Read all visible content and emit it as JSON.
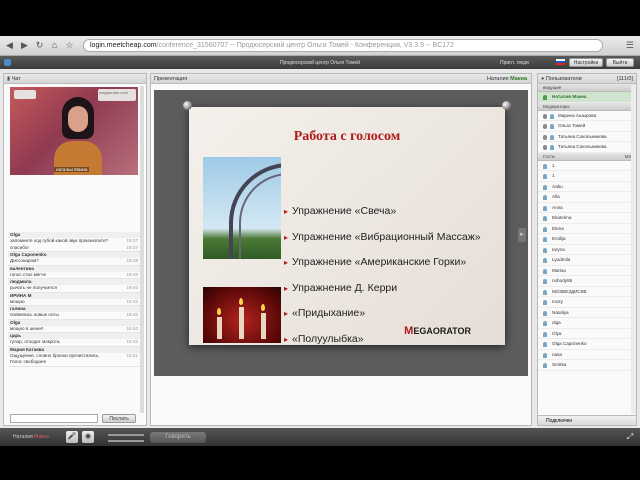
{
  "browser": {
    "url_host": "login.meetcheap.com",
    "url_path": "/conference_31560707 -- Продюсерский центр Ольги Томей - Конференция, V3.3.9 -- BC172"
  },
  "app": {
    "title": "Продюсерский центр Ольги Томей",
    "invite_label": "Пригл. люди",
    "settings_label": "Настройки",
    "exit_label": "Выйти"
  },
  "chat": {
    "title": "Чат",
    "video_caption": "натальи Макна",
    "video_sign": "megaorator.com",
    "messages": [
      {
        "author": "Olga",
        "lines": [
          [
            "запомните ход губой какой звук произносите?",
            "19:37"
          ],
          [
            "спасибо!",
            "19:37"
          ]
        ]
      },
      {
        "author": "Olga Caponenko",
        "lines": [
          [
            "Диссонаром?",
            "19:38"
          ]
        ]
      },
      {
        "author": "валентина",
        "lines": [
          [
            "голос стал мягче",
            "19:40"
          ]
        ]
      },
      {
        "author": "людмила",
        "lines": [
          [
            "рычать не получается",
            "19:40"
          ]
        ]
      },
      {
        "author": "ИРИНА М",
        "lines": [
          [
            "мощно",
            "19:40"
          ]
        ]
      },
      {
        "author": "галина",
        "lines": [
          [
            "появились новые ноты",
            "19:40"
          ]
        ]
      },
      {
        "author": "Olga",
        "lines": [
          [
            "мощно в шеее!!",
            "19:40"
          ]
        ]
      },
      {
        "author": "царь",
        "lines": [
          [
            "гулар, отходит мокрота.",
            "19:40"
          ]
        ]
      },
      {
        "author": "Мария Катаева",
        "lines": [
          [
            "Ощущение, словно бронхи прочистились.",
            "19:41"
          ],
          [
            "Голос свободнее",
            ""
          ]
        ]
      }
    ],
    "send_label": "Послать"
  },
  "presentation": {
    "title": "Презентация",
    "presenter_prefix": "Наталия",
    "presenter_name": "Макна",
    "slide": {
      "title": "Работа с голосом",
      "bullets": [
        "Упражнение «Свеча»",
        "Упражнение «Вибрационный Массаж»",
        "Упражнение «Американские Горки»",
        "Упражнение Д. Керри",
        "«Придыхание»",
        "«Полуулыбка»"
      ],
      "logo_m": "M",
      "logo_text": "EGAORATOR"
    }
  },
  "participants": {
    "title": "Пользователи",
    "count": "[111/0]",
    "groups": [
      {
        "label": "ведущие",
        "tag": "",
        "users": [
          {
            "name": "Наталия Макна",
            "type": "host"
          }
        ]
      },
      {
        "label": "Модераторы",
        "tag": "",
        "users": [
          {
            "name": "Марина Ашырова",
            "type": "mod"
          },
          {
            "name": "Ольга Томей",
            "type": "mod"
          },
          {
            "name": "Татьяна Сокольникова",
            "type": "mod"
          },
          {
            "name": "Татьяна Сокольникова",
            "type": "mod"
          }
        ]
      },
      {
        "label": "Гости",
        "tag": "MIC",
        "users": [
          {
            "name": "1",
            "type": "guest"
          },
          {
            "name": "1",
            "type": "guest"
          },
          {
            "name": "Aabu",
            "type": "guest"
          },
          {
            "name": "Alla",
            "type": "guest"
          },
          {
            "name": "Anna",
            "type": "guest"
          },
          {
            "name": "Ekaterina",
            "type": "guest"
          },
          {
            "name": "Elena",
            "type": "guest"
          },
          {
            "name": "Emilija",
            "type": "guest"
          },
          {
            "name": "Iaryna",
            "type": "guest"
          },
          {
            "name": "Lyudmila",
            "type": "guest"
          },
          {
            "name": "Marisa",
            "type": "guest"
          },
          {
            "name": "nobody55",
            "type": "guest"
          },
          {
            "name": "МОЗВЕЗДИСКВ",
            "type": "guest"
          },
          {
            "name": "mozy",
            "type": "guest"
          },
          {
            "name": "Nataliya",
            "type": "guest"
          },
          {
            "name": "olga",
            "type": "guest"
          },
          {
            "name": "Olya",
            "type": "guest"
          },
          {
            "name": "Olga Caponenko",
            "type": "guest"
          },
          {
            "name": "nasa",
            "type": "guest"
          },
          {
            "name": "Smirka",
            "type": "guest"
          }
        ]
      }
    ],
    "footer_label": "Подключен"
  },
  "bottom": {
    "me_prefix": "Наталия",
    "me_name": "Макна",
    "talk_label": "Говорить"
  }
}
